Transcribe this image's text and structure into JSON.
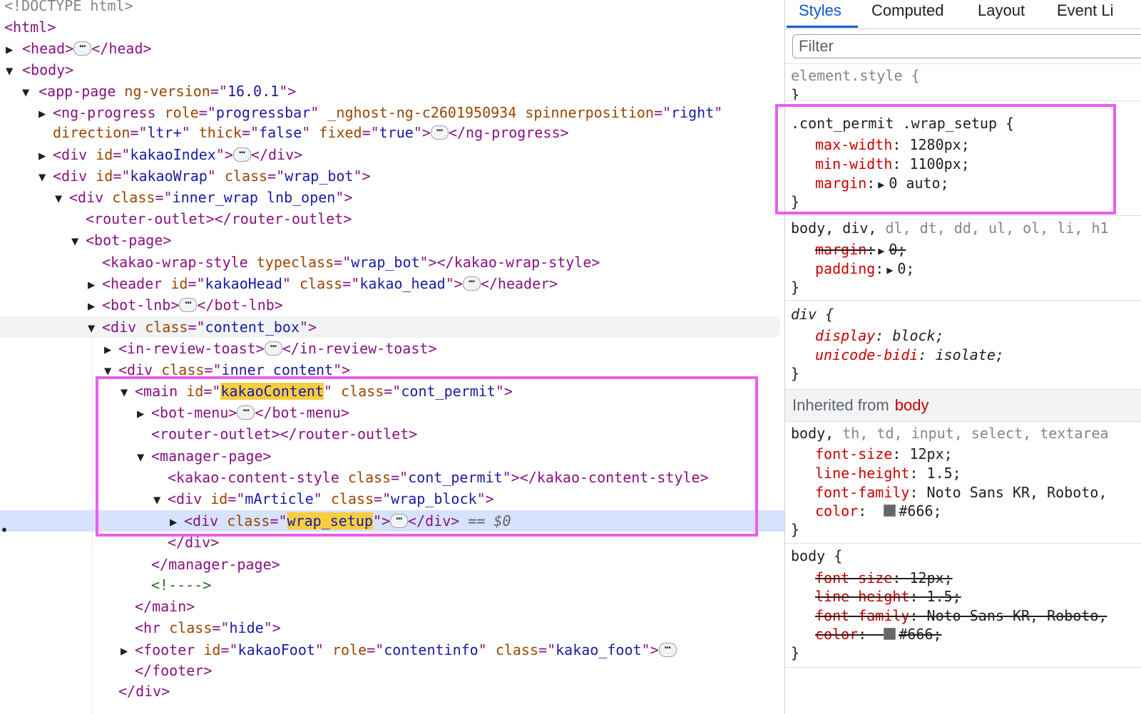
{
  "dom_tree": {
    "doctype": "<!DOCTYPE html>",
    "html_open": "<html>",
    "head": {
      "open": "<head>",
      "close": "</head>"
    },
    "body_open": "<body>",
    "app_page": {
      "tag": "app-page",
      "attr": "ng-version",
      "value": "16.0.1"
    },
    "ng_progress": {
      "tag": "ng-progress",
      "attrs1": [
        {
          "name": "role",
          "value": "progressbar"
        },
        {
          "name": "_nghost-ng-c2601950934",
          "value": null
        },
        {
          "name": "spinnerposition",
          "value": "right"
        }
      ],
      "attrs2": [
        {
          "name": "direction",
          "value": "ltr+"
        },
        {
          "name": "thick",
          "value": "false"
        },
        {
          "name": "fixed",
          "value": "true"
        }
      ]
    },
    "kakao_index": {
      "tag": "div",
      "attr": "id",
      "value": "kakaoIndex"
    },
    "kakao_wrap": {
      "tag": "div",
      "id": "kakaoWrap",
      "class": "wrap_bot"
    },
    "inner_wrap": {
      "tag": "div",
      "class": "inner_wrap lnb_open"
    },
    "router_outlet": "router-outlet",
    "bot_page": "bot-page",
    "kakao_wrap_style": {
      "tag": "kakao-wrap-style",
      "attr": "typeclass",
      "value": "wrap_bot"
    },
    "header": {
      "tag": "header",
      "id": "kakaoHead",
      "class": "kakao_head"
    },
    "bot_lnb": "bot-lnb",
    "content_box": {
      "tag": "div",
      "class": "content_box"
    },
    "in_review_toast": "in-review-toast",
    "inner_content": {
      "tag": "div",
      "class": "inner_content"
    },
    "main": {
      "tag": "main",
      "id": "kakaoContent",
      "class": "cont_permit"
    },
    "bot_menu": "bot-menu",
    "manager_page": "manager-page",
    "kakao_content_style": {
      "tag": "kakao-content-style",
      "class": "cont_permit"
    },
    "m_article": {
      "tag": "div",
      "id": "mArticle",
      "class": "wrap_block"
    },
    "wrap_setup": {
      "tag": "div",
      "class": "wrap_setup",
      "suffix_eq": "==",
      "suffix_var": "$0"
    },
    "close_div": "</div>",
    "close_manager_page": "</manager-page>",
    "comment": "<!---->",
    "close_main": "</main>",
    "hr": {
      "tag": "hr",
      "class": "hide"
    },
    "footer": {
      "tag": "footer",
      "id": "kakaoFoot",
      "role": "contentinfo",
      "class": "kakao_foot"
    },
    "close_footer": "</footer>",
    "close_div_2": "</div>",
    "row_marker": "•"
  },
  "styles_panel": {
    "tabs": [
      "Styles",
      "Computed",
      "Layout",
      "Event Li"
    ],
    "active_tab": "Styles",
    "filter_placeholder": "Filter",
    "rules": {
      "element_style": {
        "selector": "element.style {",
        "close": "}"
      },
      "cont_permit": {
        "selector": ".cont_permit .wrap_setup {",
        "props": [
          {
            "name": "max-width",
            "value": "1280px;"
          },
          {
            "name": "min-width",
            "value": "1100px;"
          },
          {
            "name": "margin",
            "value": "0 auto;"
          }
        ],
        "close": "}"
      },
      "body_reset": {
        "selector_active": "body, div,",
        "selector_rest": " dl, dt, dd, ul, ol, li, h1",
        "props": [
          {
            "name": "margin",
            "value": "0;",
            "overridden": true
          },
          {
            "name": "padding",
            "value": "0;",
            "overridden": false
          }
        ],
        "close": "}"
      },
      "div_ua": {
        "selector": "div {",
        "props": [
          {
            "name": "display",
            "value": "block;"
          },
          {
            "name": "unicode-bidi",
            "value": "isolate;"
          }
        ],
        "close": "}"
      }
    },
    "inherited": {
      "label": "Inherited from",
      "element": "body"
    },
    "inherited_rules": {
      "body_inputs": {
        "selector_active": "body,",
        "selector_rest": " th, td, input, select, textarea",
        "props": [
          {
            "name": "font-size",
            "value": "12px;"
          },
          {
            "name": "line-height",
            "value": "1.5;"
          },
          {
            "name": "font-family",
            "value": "Noto Sans KR, Roboto,"
          },
          {
            "name": "color",
            "value": "#666;"
          }
        ],
        "close": "}"
      },
      "body_only": {
        "selector": "body {",
        "props": [
          {
            "name": "font-size",
            "value": "12px;"
          },
          {
            "name": "line-height",
            "value": "1.5;"
          },
          {
            "name": "font-family",
            "value": "Noto Sans KR, Roboto,"
          },
          {
            "name": "color",
            "value": "#666;"
          }
        ],
        "close": "}"
      }
    }
  },
  "colors": {
    "highlight_box": "#e95ef0",
    "selected_row": "#d7e2fc",
    "accent": "#0b57d0",
    "swatch": "#666666"
  }
}
